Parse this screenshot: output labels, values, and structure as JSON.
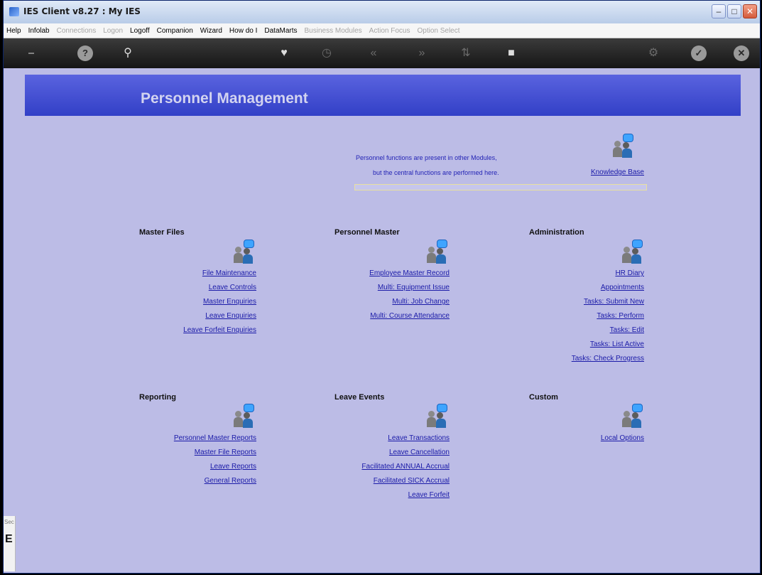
{
  "window": {
    "title": "IES Client v8.27 : My IES"
  },
  "menu": [
    {
      "label": "Help",
      "enabled": true
    },
    {
      "label": "Infolab",
      "enabled": true
    },
    {
      "label": "Connections",
      "enabled": false
    },
    {
      "label": "Logon",
      "enabled": false
    },
    {
      "label": "Logoff",
      "enabled": true
    },
    {
      "label": "Companion",
      "enabled": true
    },
    {
      "label": "Wizard",
      "enabled": true
    },
    {
      "label": "How do I",
      "enabled": true
    },
    {
      "label": "DataMarts",
      "enabled": true
    },
    {
      "label": "Business Modules",
      "enabled": false
    },
    {
      "label": "Action Focus",
      "enabled": false
    },
    {
      "label": "Option Select",
      "enabled": false
    }
  ],
  "page": {
    "title": "Personnel Management"
  },
  "info": {
    "line1": "Personnel functions are present in other Modules,",
    "line2": "but the central functions are performed here.",
    "knowledge_base": "Knowledge Base"
  },
  "sections": {
    "master_files": {
      "title": "Master Files",
      "links": [
        "File Maintenance",
        "Leave Controls",
        "Master Enquiries",
        "Leave Enquiries",
        "Leave Forfeit Enquiries"
      ]
    },
    "personnel_master": {
      "title": "Personnel Master",
      "links": [
        "Employee Master Record",
        "Multi: Equipment Issue",
        "Multi: Job Change",
        "Multi: Course Attendance"
      ]
    },
    "administration": {
      "title": "Administration",
      "links": [
        "HR Diary",
        "Appointments",
        "Tasks: Submit New",
        "Tasks: Perform",
        "Tasks: Edit",
        "Tasks: List Active",
        "Tasks: Check Progress"
      ]
    },
    "reporting": {
      "title": "Reporting",
      "links": [
        "Personnel Master Reports",
        "Master File Reports",
        "Leave Reports",
        "General Reports"
      ]
    },
    "leave_events": {
      "title": "Leave Events",
      "links": [
        "Leave Transactions",
        "Leave Cancellation",
        "Facilitated ANNUAL Accrual",
        "Facilitated SICK Accrual",
        "Leave Forfeit"
      ]
    },
    "custom": {
      "title": "Custom",
      "links": [
        "Local Options"
      ]
    }
  },
  "side_stub": {
    "label_top": "Sec",
    "label_big": "E"
  }
}
